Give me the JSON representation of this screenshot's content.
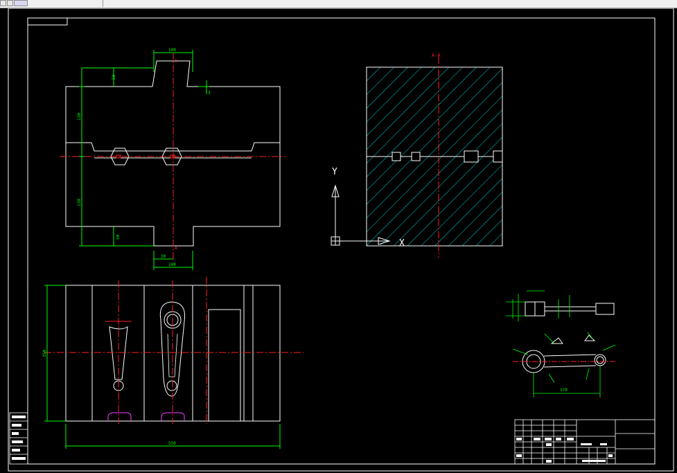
{
  "window": {
    "toolbar_buttons": [
      "",
      "",
      ""
    ]
  },
  "drawing": {
    "section_label": "A-A",
    "axis_y_label": "Y",
    "axis_x_label": "X",
    "top_view": {
      "dim_top_width": "100",
      "dim_top_center": "A",
      "dim_left_upper_small": "50",
      "dim_left_upper_large": "130",
      "dim_left_lower_large": "130",
      "dim_left_lower_small": "50",
      "dim_bottom_gate": "30",
      "dim_bottom_center": "A",
      "dim_bottom_width": "100",
      "dim_right_small": "3"
    },
    "front_view": {
      "dim_height": "350",
      "dim_width": "550"
    },
    "part_detail": {
      "dim_length": "170"
    },
    "title_block": {
      "left_labels": [
        "",
        "",
        "",
        "",
        "",
        ""
      ]
    }
  },
  "colors": {
    "background": "#000000",
    "outline": "#ffffff",
    "centerline": "#ff2020",
    "dimension": "#00ff00",
    "hatch": "#00d8d8",
    "gate": "#ff40ff"
  }
}
